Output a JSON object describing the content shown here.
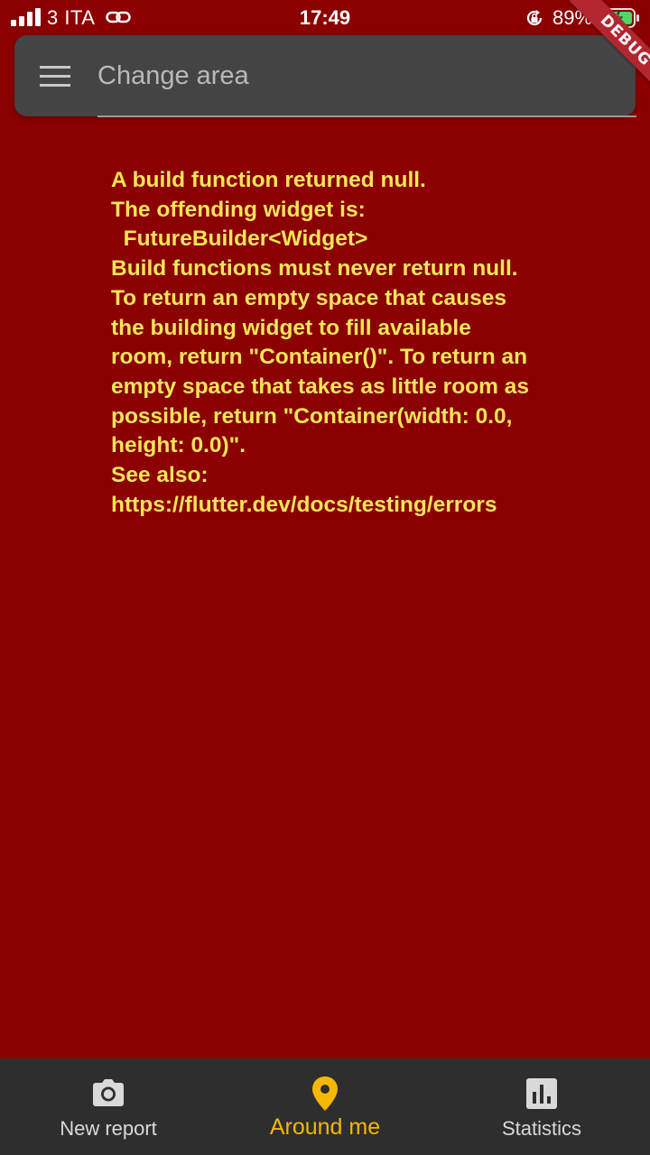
{
  "status_bar": {
    "carrier": "3 ITA",
    "time": "17:49",
    "battery": "89%",
    "icons": [
      "signal-icon",
      "link-icon",
      "rotation-lock-icon",
      "battery-charging-icon"
    ]
  },
  "debug_banner": "DEBUG",
  "search": {
    "placeholder": "Change area",
    "icon": "menu-icon"
  },
  "error": {
    "message": "A build function returned null.\nThe offending widget is:\n  FutureBuilder<Widget>\nBuild functions must never return null.\nTo return an empty space that causes the building widget to fill available room, return \"Container()\". To return an empty space that takes as little room as possible, return \"Container(width: 0.0, height: 0.0)\".\nSee also: https://flutter.dev/docs/testing/errors"
  },
  "bottom_nav": {
    "items": [
      {
        "label": "New report",
        "icon": "camera-icon",
        "active": false
      },
      {
        "label": "Around me",
        "icon": "location-pin-icon",
        "active": true
      },
      {
        "label": "Statistics",
        "icon": "bar-chart-icon",
        "active": false
      }
    ]
  },
  "colors": {
    "background": "#8b0000",
    "error_text": "#f7e45a",
    "search_bar": "#444444",
    "nav_background": "#2e2e2e",
    "nav_active": "#f5b700",
    "nav_inactive": "#d9d9d9",
    "debug_banner": "#b3262f"
  }
}
